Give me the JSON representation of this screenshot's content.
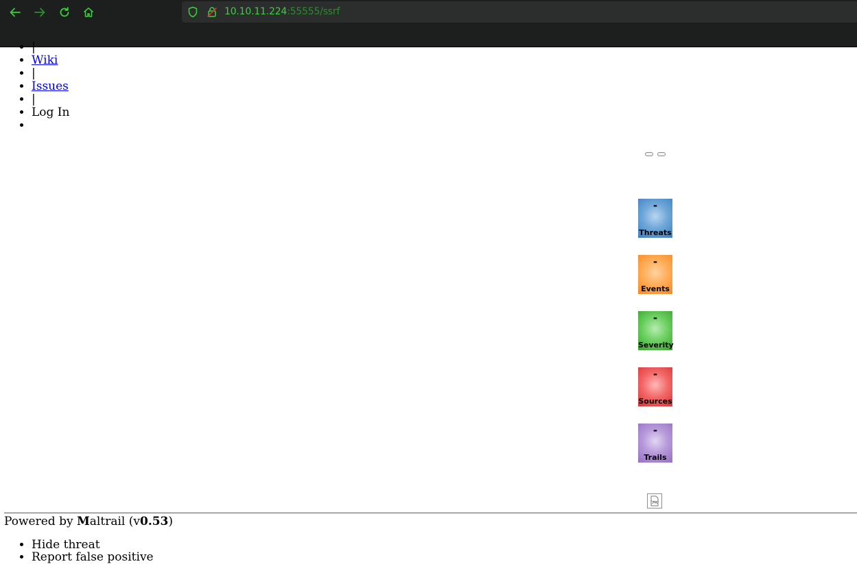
{
  "browser": {
    "url_host": "10.10.11.224",
    "url_rest": ":55555/ssrf",
    "icons": [
      "back-icon",
      "forward-icon",
      "reload-icon",
      "home-icon",
      "shield-icon",
      "lock-insecure-icon"
    ],
    "accent": "#39d239"
  },
  "topnav": {
    "items": [
      {
        "text": "|",
        "link": false
      },
      {
        "text": "Wiki",
        "link": true
      },
      {
        "text": "|",
        "link": false
      },
      {
        "text": "Issues",
        "link": true
      },
      {
        "text": "|",
        "link": false
      },
      {
        "text": "Log In",
        "link": false
      },
      {
        "text": "",
        "link": false
      }
    ]
  },
  "counters": [
    {
      "value": "-",
      "label": "Threats",
      "color": "#4a8ccc"
    },
    {
      "value": "-",
      "label": "Events",
      "color": "#ff9933"
    },
    {
      "value": "-",
      "label": "Severity",
      "color": "#44b33a"
    },
    {
      "value": "-",
      "label": "Sources",
      "color": "#e84141"
    },
    {
      "value": "-",
      "label": "Trails",
      "color": "#a17fcb"
    }
  ],
  "footer": {
    "prefix": "Powered by ",
    "brand_initial": "M",
    "brand_rest": "altrail",
    "version_open": " (v",
    "version": "0.53",
    "version_close": ")"
  },
  "context_menu": {
    "items": [
      "Hide threat",
      "Report false positive"
    ]
  }
}
